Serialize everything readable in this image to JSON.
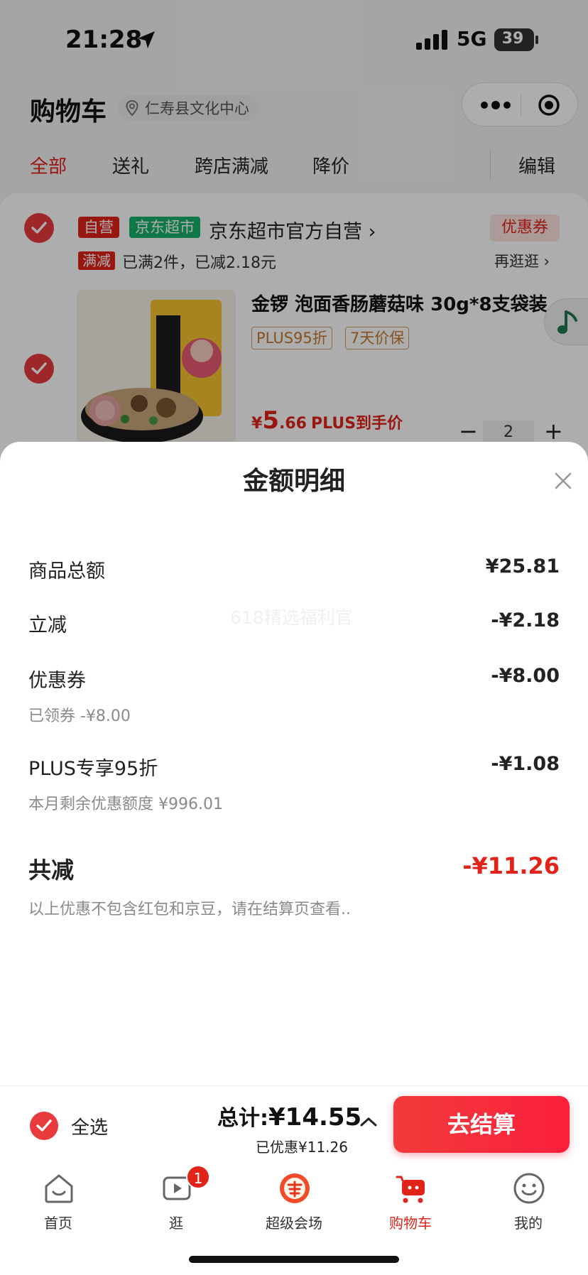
{
  "status_bar": {
    "time": "21:28",
    "network": "5G",
    "battery": "39"
  },
  "header": {
    "title": "购物车",
    "location": "仁寿县文化中心"
  },
  "tabs": {
    "items": [
      "全部",
      "送礼",
      "跨店满减",
      "降价"
    ],
    "active": "全部",
    "edit": "编辑"
  },
  "shop": {
    "tag_self": "自营",
    "tag_market": "京东超市",
    "name": "京东超市官方自营 ›",
    "coupon": "优惠券",
    "promo_tag": "满减",
    "promo_text": "已满2件，已减2.18元",
    "more_link": "再逛逛 ›"
  },
  "product": {
    "title": "金锣 泡面香肠蘑菇味 30g*8支袋装",
    "badges": [
      "PLUS95折",
      "7天价保"
    ],
    "price_yen": "¥",
    "price_int": "5",
    "price_dec": ".66",
    "price_label": "PLUS到手价",
    "qty": "2",
    "minus": "−",
    "plus": "+"
  },
  "sheet": {
    "title": "金额明细",
    "watermark": "618精选福利官",
    "rows": [
      {
        "label": "商品总额",
        "value": "¥25.81",
        "sub": ""
      },
      {
        "label": "立减",
        "value": "-¥2.18",
        "sub": ""
      },
      {
        "label": "优惠券",
        "value": "-¥8.00",
        "sub": "已领券 -¥8.00"
      },
      {
        "label": "PLUS专享95折",
        "value": "-¥1.08",
        "sub": "本月剩余优惠额度 ¥996.01"
      }
    ],
    "total_label": "共减",
    "total_value": "-¥11.26",
    "note": "以上优惠不包含红包和京豆，请在结算页查看.."
  },
  "checkout": {
    "select_all": "全选",
    "total_prefix": "总计:",
    "total_amount": "¥14.55",
    "saved": "已优惠¥11.26",
    "button": "去结算"
  },
  "tabbar": {
    "items": [
      {
        "label": "首页",
        "icon": "home-icon"
      },
      {
        "label": "逛",
        "icon": "video-icon",
        "badge": "1"
      },
      {
        "label": "超级会场",
        "icon": "super-venue-icon"
      },
      {
        "label": "购物车",
        "icon": "cart-icon"
      },
      {
        "label": "我的",
        "icon": "smile-icon"
      }
    ],
    "active": "购物车"
  },
  "colors": {
    "accent": "#e2231a",
    "green": "#18b26b",
    "badge_border": "#d39a62"
  }
}
